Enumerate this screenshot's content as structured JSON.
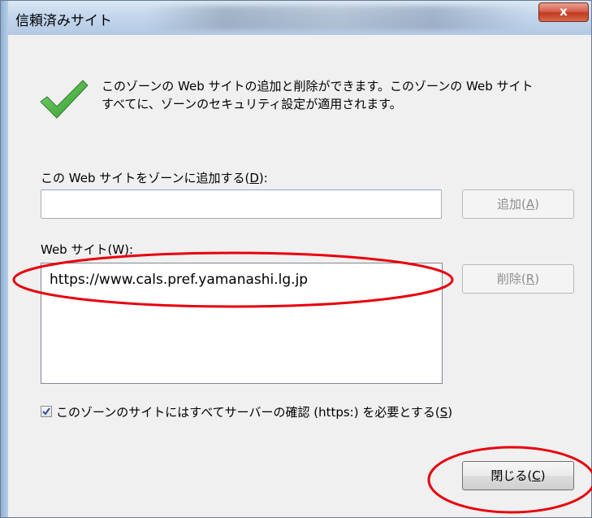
{
  "window": {
    "title": "信頼済みサイト",
    "close_label": "x"
  },
  "info": {
    "line1": "このゾーンの Web サイトの追加と削除ができます。このゾーンの Web サイト",
    "line2": "すべてに、ゾーンのセキュリティ設定が適用されます。",
    "icon": "green-checkmark-icon"
  },
  "add_field": {
    "label_prefix": "この Web サイトをゾーンに追加する(",
    "label_key": "D",
    "label_suffix": "):",
    "value": ""
  },
  "add_button": {
    "text": "追加(",
    "key": "A",
    "suffix": ")",
    "enabled": false
  },
  "websites": {
    "label": "Web サイト(W):",
    "items": [
      "https://www.cals.pref.yamanashi.lg.jp"
    ]
  },
  "remove_button": {
    "text": "削除(",
    "key": "R",
    "suffix": ")",
    "enabled": false
  },
  "https_check": {
    "label_prefix": "このゾーンのサイトにはすべてサーバーの確認 (https:) を必要とする(",
    "label_key": "S",
    "label_suffix": ")",
    "checked": true
  },
  "close_button": {
    "text": "閉じる(",
    "key": "C",
    "suffix": ")"
  },
  "annotations": {
    "color": "#e8000d",
    "shape": "ellipse"
  }
}
